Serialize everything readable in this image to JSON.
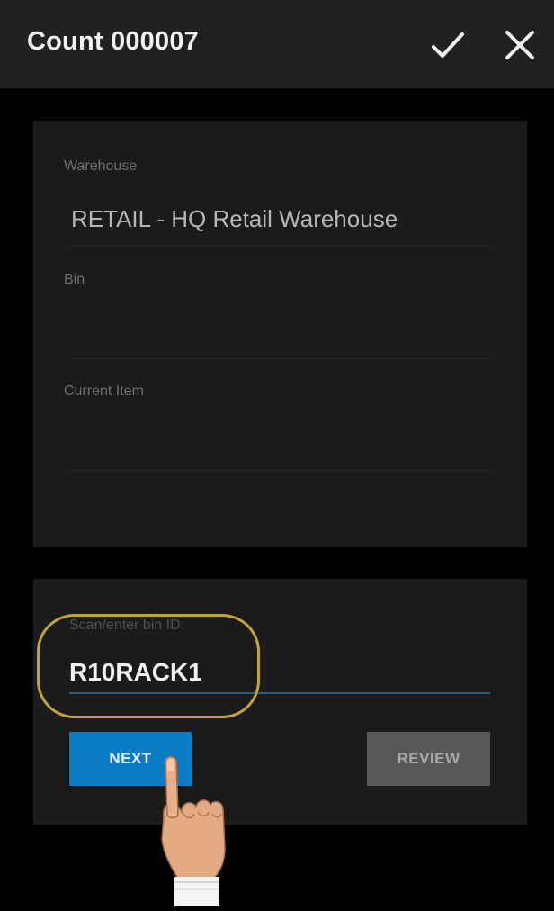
{
  "app_bar": {
    "title": "Count 000007",
    "confirm_icon": "check-icon",
    "close_icon": "close-icon"
  },
  "info_card": {
    "warehouse_label": "Warehouse",
    "warehouse_value": "RETAIL - HQ Retail Warehouse",
    "bin_label": "Bin",
    "bin_value": "",
    "current_item_label": "Current Item",
    "current_item_value": ""
  },
  "scan_card": {
    "label": "Scan/enter bin ID:",
    "input_value": "R10RACK1",
    "next_label": "NEXT",
    "review_label": "REVIEW"
  },
  "colors": {
    "accent": "#0a7bc6",
    "highlight": "#c4a33a",
    "input_underline": "#1f5f86"
  }
}
